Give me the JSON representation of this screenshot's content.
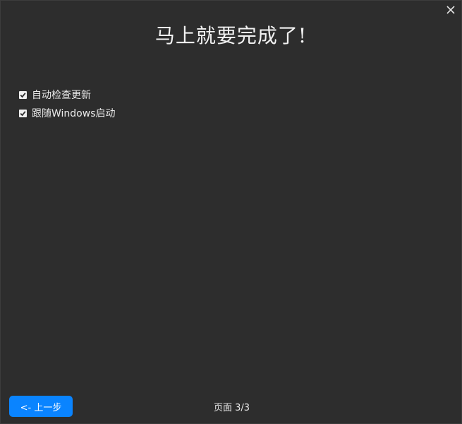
{
  "window": {
    "close_icon": "close-icon",
    "title": "马上就要完成了!"
  },
  "options": [
    {
      "label": "自动检查更新",
      "checked": true
    },
    {
      "label": "跟随Windows启动",
      "checked": true
    }
  ],
  "footer": {
    "back_button_label": "<- 上一步",
    "page_indicator": "页面 3/3"
  },
  "colors": {
    "background": "#2d2d2d",
    "accent": "#0a84ff",
    "text": "#ffffff"
  }
}
